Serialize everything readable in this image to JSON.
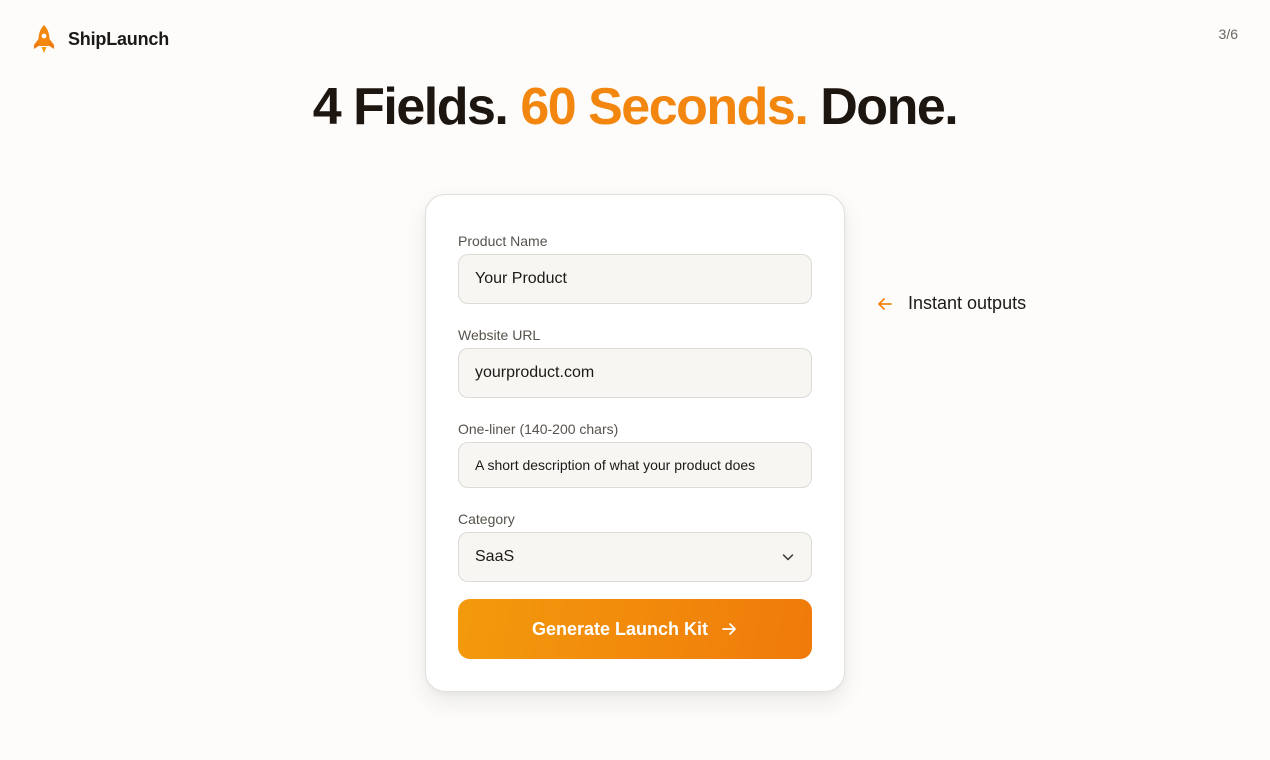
{
  "brand": {
    "name": "ShipLaunch",
    "icon": "rocket-icon",
    "accent_color": "#f2860f"
  },
  "slide_counter": "3/6",
  "headline": {
    "part1": "4 Fields.",
    "accent": "60 Seconds.",
    "part2": "Done."
  },
  "form": {
    "product_name": {
      "label": "Product Name",
      "value": "Your Product"
    },
    "website_url": {
      "label": "Website URL",
      "value": "yourproduct.com"
    },
    "one_liner": {
      "label": "One-liner (140-200 chars)",
      "value": "A short description of what your product does"
    },
    "category": {
      "label": "Category",
      "selected": "SaaS",
      "icon": "chevron-down-icon"
    },
    "submit": {
      "label": "Generate Launch Kit",
      "icon": "arrow-right-icon"
    }
  },
  "side_note": {
    "text": "Instant outputs",
    "icon": "arrow-left-icon"
  }
}
